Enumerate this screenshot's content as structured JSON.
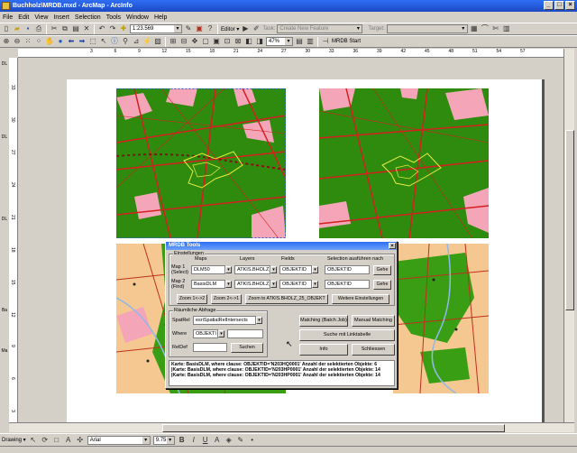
{
  "window": {
    "title": "Buchholz\\MRDB.mxd - ArcMap - ArcInfo",
    "controls": [
      "_",
      "□",
      "×"
    ]
  },
  "menu": [
    "File",
    "Edit",
    "View",
    "Insert",
    "Selection",
    "Tools",
    "Window",
    "Help"
  ],
  "toolbar1": {
    "scale": "1:23.569",
    "editor_label": "Editor ▾",
    "task_label": "Task:",
    "task_value": "Create New Feature",
    "target_label": "Target:"
  },
  "toolbar2": {
    "zoom": "47%",
    "mrdb_start": "MRDB Start"
  },
  "ruler": {
    "h_ticks": [
      "3",
      "6",
      "9",
      "12",
      "15",
      "18",
      "21",
      "24",
      "27",
      "30",
      "33",
      "36",
      "39",
      "42",
      "45",
      "48",
      "51",
      "54",
      "57"
    ],
    "v_ticks": [
      "33",
      "30",
      "27",
      "24",
      "21",
      "18",
      "15",
      "12",
      "9",
      "6",
      "3"
    ]
  },
  "left_strip": {
    "labels": [
      "DL",
      "Ba",
      "Ma"
    ]
  },
  "drawbar": {
    "drawing_label": "Drawing ▾",
    "font_name": "Arial",
    "font_size": "9.75",
    "bold": "B",
    "italic": "I",
    "underline": "U"
  },
  "dialog": {
    "title": "MRDB Tools",
    "close": "×",
    "einstellungen": {
      "group_label": "Einstellungen",
      "col_maps": "Maps",
      "col_layers": "Layers",
      "col_fields": "Fields",
      "col_selection": "Selection ausführen nach",
      "map1_label": "Map 1 (Select)",
      "map1_map": "DLM50",
      "map1_layer": "ATKIS.BHOLZ_",
      "map1_field": "OBJEKTID",
      "map1_sel": "OBJEKTID",
      "map1_go": "Gehe",
      "map2_label": "Map 2 (Find)",
      "map2_map": "BasisDLM",
      "map2_layer": "ATKIS.BHOLZ_",
      "map2_field": "OBJEKTID",
      "map2_sel": "OBJEKTID",
      "map2_go": "Gehe",
      "zoom1": "Zoom 1<->2",
      "zoom2": "Zoom 2<->1",
      "zoom_to": "Zoom to ATKIS.BHOLZ_25_OBJEKT",
      "weitere": "Weitere Einstellungen"
    },
    "raeumlich": {
      "group_label": "Räumliche Abfrage",
      "spatrel_label": "SpatRel",
      "spatrel_value": "esriSpatialRelIntersects",
      "where_label": "Where",
      "where_value": "OBJEKTI",
      "reldef_label": "RelDef",
      "suchen": "Suchen"
    },
    "buttons": {
      "matching_batch": "Matching (Batch Job)",
      "manual_matching": "Manual Matching",
      "suche_link": "Suche mit Linktabelle",
      "info": "Info",
      "schliessen": "Schliessen"
    },
    "log": [
      "Karte: BasisDLM,  where clause: OBJEKTID='N203HQ0001'   Anzahl der selektierten Objekte: 6",
      "|Karte: BasisDLM,  where clause: OBJEKTID='N203HP0001'   Anzahl der selektierten Objekte: 14",
      "|Karte: BasisDLM,  where clause: OBJEKTID='N203HP0001'   Anzahl der selektierten Objekte: 14"
    ]
  },
  "colors": {
    "forest": "#2e8b0e",
    "settlement": "#f4a6b8",
    "road": "#d42020",
    "highlight": "#e8ec40",
    "sand": "#f4c890",
    "water": "#90b8e8"
  }
}
